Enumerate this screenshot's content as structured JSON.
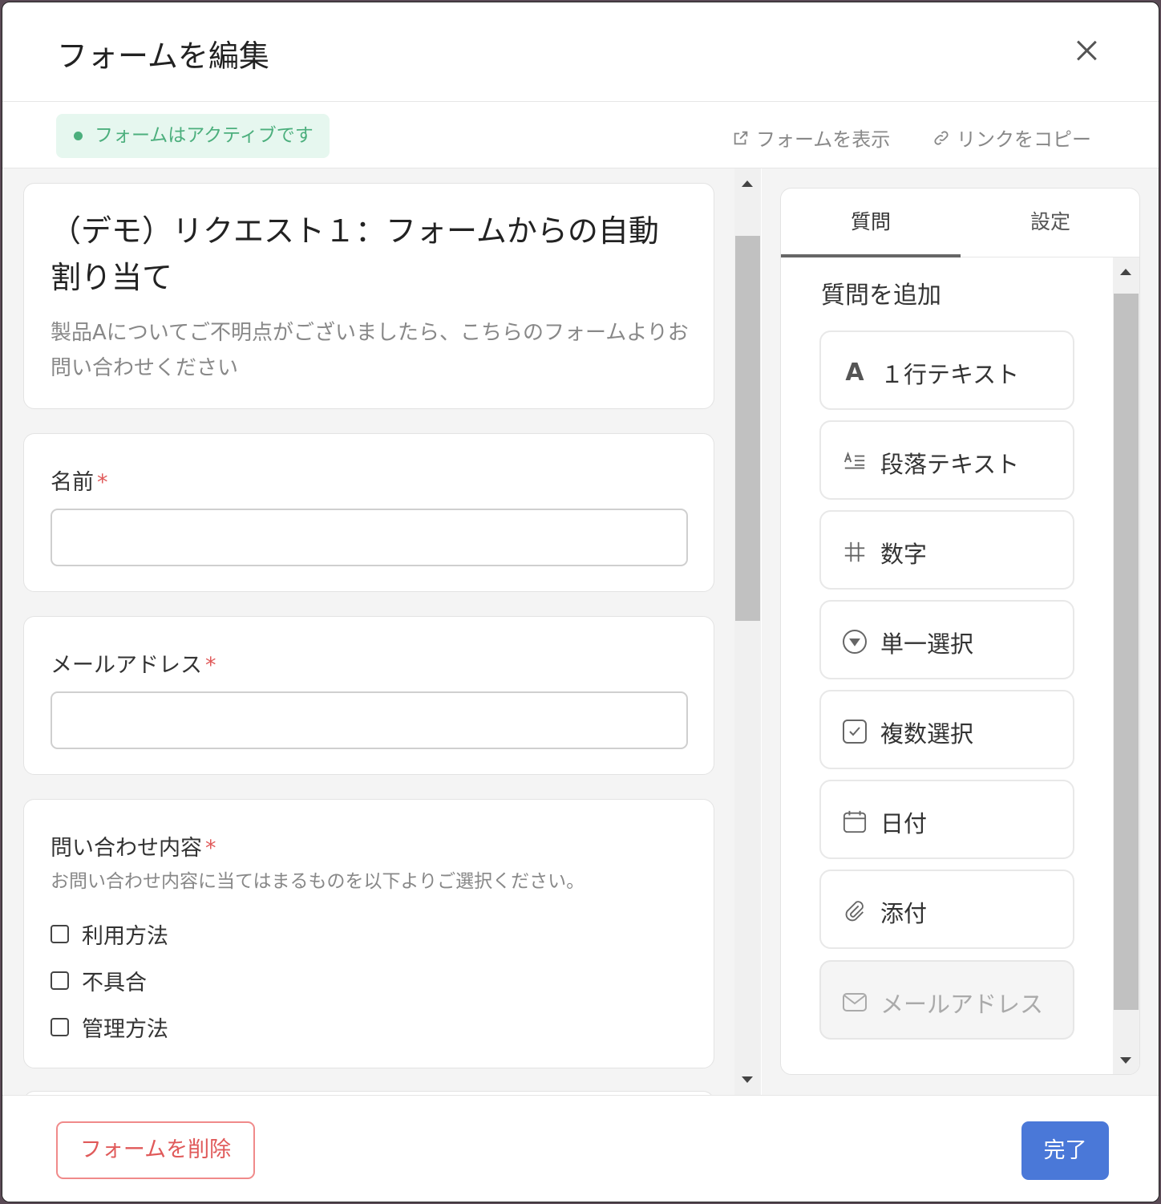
{
  "header": {
    "title": "フォームを編集"
  },
  "status": {
    "badge": "フォームはアクティブです",
    "view_form": "フォームを表示",
    "copy_link": "リンクをコピー"
  },
  "form": {
    "title": "（デモ）リクエスト１：フォームからの自動割り当て",
    "description": "製品Aについてご不明点がございましたら、こちらのフォームよりお問い合わせください",
    "fields": [
      {
        "label": "名前",
        "required_mark": "*"
      },
      {
        "label": "メールアドレス",
        "required_mark": "*"
      },
      {
        "label": "問い合わせ内容",
        "required_mark": "*",
        "help": "お問い合わせ内容に当てはまるものを以下よりご選択ください。",
        "options": [
          "利用方法",
          "不具合",
          "管理方法"
        ]
      }
    ]
  },
  "sidebar": {
    "tabs": [
      "質問",
      "設定"
    ],
    "active_tab": "質問",
    "heading": "質問を追加",
    "question_types": [
      {
        "label": "１行テキスト",
        "icon": "text-a-icon"
      },
      {
        "label": "段落テキスト",
        "icon": "paragraph-icon"
      },
      {
        "label": "数字",
        "icon": "hash-icon"
      },
      {
        "label": "単一選択",
        "icon": "dropdown-circle-icon"
      },
      {
        "label": "複数選択",
        "icon": "checkbox-icon"
      },
      {
        "label": "日付",
        "icon": "calendar-icon"
      },
      {
        "label": "添付",
        "icon": "paperclip-icon"
      },
      {
        "label": "メールアドレス",
        "icon": "mail-icon",
        "disabled": true
      }
    ]
  },
  "footer": {
    "delete_label": "フォームを削除",
    "done_label": "完了"
  },
  "colors": {
    "accent": "#4a78d8",
    "danger": "#e05a5a",
    "active_green": "#4caf7d"
  }
}
